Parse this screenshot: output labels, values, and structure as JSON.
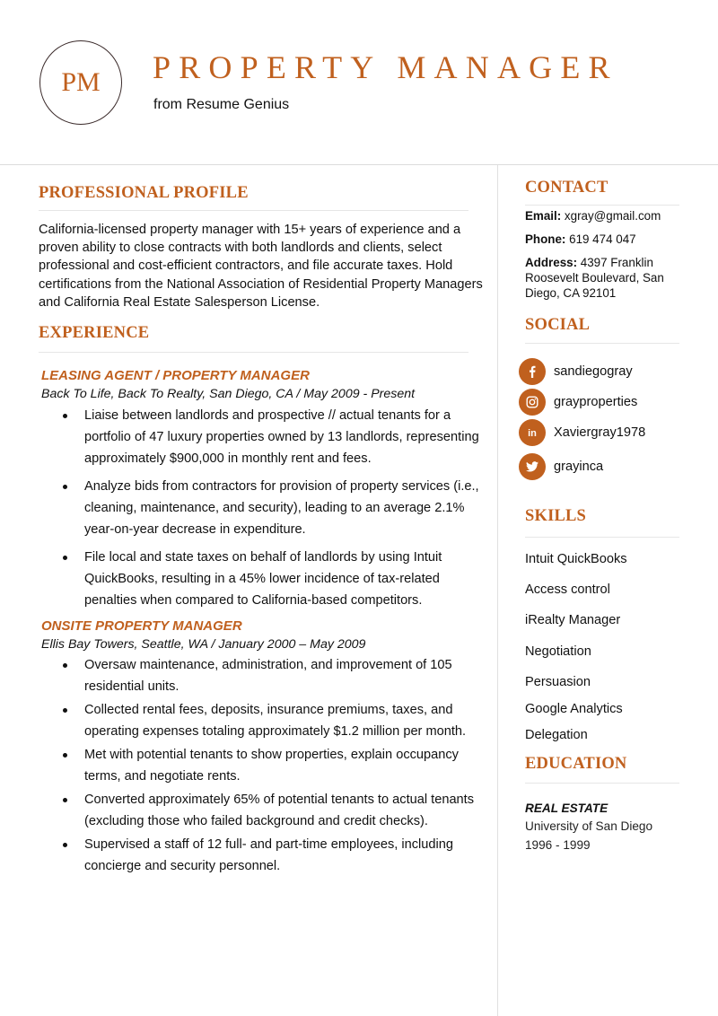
{
  "header": {
    "monogram": "PM",
    "title": "PROPERTY MANAGER",
    "subtitle": "from Resume Genius"
  },
  "colors": {
    "accent": "#c0601e",
    "text": "#111111",
    "rule": "#e6e6e6"
  },
  "profile": {
    "heading": "PROFESSIONAL PROFILE",
    "text": "California-licensed property manager with 15+ years of experience and a proven ability to close contracts with both landlords and clients, select professional and cost-efficient contractors, and file accurate taxes. Hold certifications from the National Association of Residential Property Managers and California Real Estate Salesperson License."
  },
  "experience": {
    "heading": "EXPERIENCE",
    "jobs": [
      {
        "title": "LEASING AGENT / PROPERTY MANAGER",
        "meta": "Back To Life, Back To Realty, San Diego, CA  /  May 2009 - Present",
        "bullets": [
          "Liaise between landlords and prospective // actual tenants for a portfolio of 47 luxury properties owned by 13 landlords, representing approximately $900,000 in monthly rent and fees.",
          "Analyze bids from contractors for provision of property services (i.e., cleaning, maintenance, and security), leading to an average 2.1% year-on-year decrease in expenditure.",
          "File local and state taxes on behalf of landlords by using Intuit QuickBooks, resulting in a 45% lower incidence of tax-related penalties when compared to California-based competitors."
        ]
      },
      {
        "title": "ONSITE PROPERTY MANAGER",
        "meta": "Ellis Bay Towers, Seattle, WA  /  January 2000 – May 2009",
        "bullets": [
          "Oversaw maintenance, administration, and improvement of 105 residential units.",
          "Collected rental fees, deposits, insurance premiums, taxes, and operating expenses totaling approximately $1.2 million per month.",
          "Met with potential tenants to show properties, explain occupancy terms, and negotiate rents.",
          "Converted approximately 65% of potential tenants to actual tenants (excluding those who failed background and credit checks).",
          "Supervised a staff of 12 full- and part-time employees, including concierge and security personnel."
        ]
      }
    ]
  },
  "contact": {
    "heading": "CONTACT",
    "email_label": "Email:",
    "email": "xgray@gmail.com",
    "phone_label": "Phone:",
    "phone": "619 474 047",
    "address_label": "Address:",
    "address": "4397 Franklin Roosevelt Boulevard, San Diego, CA 92101"
  },
  "social": {
    "heading": "SOCIAL",
    "items": [
      {
        "icon": "facebook-icon",
        "label": "sandiegogray"
      },
      {
        "icon": "instagram-icon",
        "label": "grayproperties"
      },
      {
        "icon": "linkedin-icon",
        "label": "Xaviergray1978"
      },
      {
        "icon": "twitter-icon",
        "label": "grayinca"
      }
    ]
  },
  "skills": {
    "heading": "SKILLS",
    "items": [
      "Intuit QuickBooks",
      "Access control",
      "iRealty Manager",
      "Negotiation",
      "Persuasion",
      "Google Analytics",
      "Delegation"
    ]
  },
  "education": {
    "heading": "EDUCATION",
    "degree": "REAL ESTATE",
    "school": "University of San Diego",
    "years": "1996 - 1999"
  }
}
